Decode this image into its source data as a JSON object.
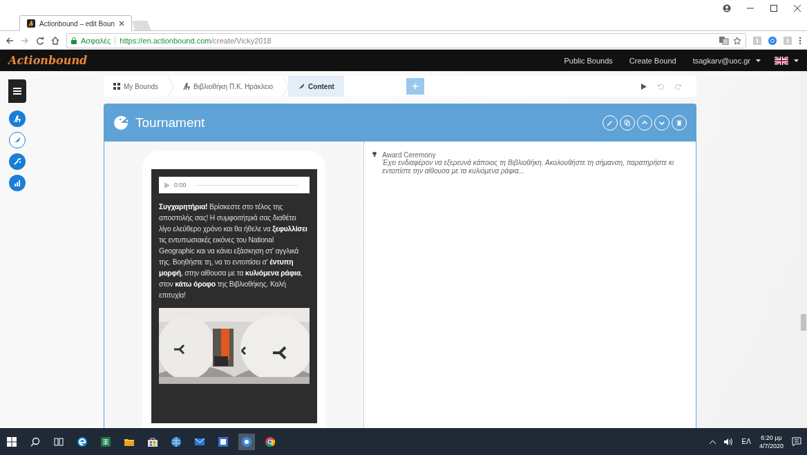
{
  "browser": {
    "tab_title": "Actionbound – edit Boun",
    "secure_label": "Ασφαλές",
    "url_host": "https://en.actionbound.com",
    "url_path": "/create/Vicky2018"
  },
  "navbar": {
    "logo": "Actionbound",
    "links": [
      "Public Bounds",
      "Create Bound"
    ],
    "user": "tsagkarv@uoc.gr"
  },
  "sidebar": {
    "items": [
      {
        "kind": "bound",
        "selected": false
      },
      {
        "kind": "content",
        "selected": true
      },
      {
        "kind": "settings",
        "selected": false
      },
      {
        "kind": "stats",
        "selected": false
      }
    ]
  },
  "breadcrumbs": [
    {
      "kind": "grid",
      "label": "My Bounds",
      "selected": false
    },
    {
      "kind": "bound",
      "label": "Βιβλιοθήκη Π.Κ. Ηράκλειο",
      "selected": false
    },
    {
      "kind": "content",
      "label": "Content",
      "selected": true
    }
  ],
  "panel": {
    "title": "Tournament",
    "preview": {
      "audio_time": "0:00",
      "text": "**Συγχαρητήρια!** Βρίσκεστε στο τέλος της αποστολής σας! Η συμφοιτήτριά σας διαθέτει λίγο ελεύθερο χρόνο και θα ήθελε να **ξεφυλλίσει** τις εντυπωσιακές εικόνες του National Geographic και να κάνει εξάσκηση στ' αγγλικά της. Βοηθήστε τη, να το εντοπίσει σ' **έντυπη μορφή**, στην αίθουσα με τα **κυλιόμενα ράφια**, στον **κάτω όροφο** της Βιβλιοθήκης. Καλή επιτυχία!"
    },
    "award": {
      "title": "Award Ceremony",
      "description": "Έχει ενδιαφέρον να εξερευνά κάποιος τη Βιβλιοθήκη. Ακολουθήστε τη σήμανση, παρατηρήστε κι εντοπίστε την αίθουσα με τα κυλιόμενα ράφια..."
    }
  },
  "taskbar": {
    "language": "ΕΛ",
    "time": "6:20 μμ",
    "date": "4/7/2020"
  }
}
